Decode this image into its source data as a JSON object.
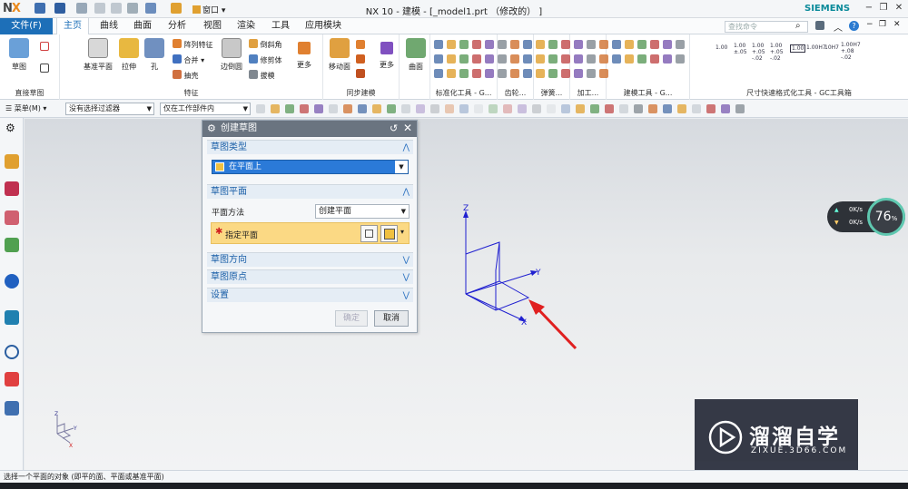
{
  "app": {
    "title": "NX 10 - 建模 - [_model1.prt （修改的） ]",
    "brand": "SIEMENS",
    "window_menu": "窗口"
  },
  "menu": {
    "file": "文件(F)",
    "tabs": [
      "主页",
      "曲线",
      "曲面",
      "分析",
      "视图",
      "渲染",
      "工具",
      "应用模块"
    ],
    "active": "主页",
    "search_placeholder": "查找命令"
  },
  "ribbon": {
    "groups": [
      {
        "label": "直接草图",
        "items": [
          "草图"
        ]
      },
      {
        "label": "特征",
        "items": [
          "基准平面",
          "拉伸",
          "孔",
          "阵列特征",
          "合并",
          "抽壳",
          "边倒圆",
          "倒斜角",
          "修剪体",
          "拔模",
          "更多"
        ]
      },
      {
        "label": "同步建模",
        "items": [
          "移动面",
          "更多"
        ]
      },
      {
        "label": "",
        "items": [
          "曲面"
        ]
      },
      {
        "label": "标准化工具 - G...",
        "items": []
      },
      {
        "label": "齿轮...",
        "items": []
      },
      {
        "label": "弹簧...",
        "items": []
      },
      {
        "label": "加工...",
        "items": []
      },
      {
        "label": "建模工具 - G...",
        "items": []
      },
      {
        "label": "尺寸快速格式化工具 - GC工具箱",
        "items": [
          "1.00",
          "1.00 ±.05",
          "1.00 +.05 -.02",
          "1.00 +.05 -.02",
          "1.00",
          "1.00H7",
          "10H7",
          "1.00H7 +.08 -.02"
        ]
      }
    ]
  },
  "selection_bar": {
    "menu": "菜单(M)",
    "filter": "没有选择过滤器",
    "scope": "仅在工作部件内"
  },
  "dialog": {
    "title": "创建草图",
    "sections": {
      "sketch_type": "草图类型",
      "sketch_plane": "草图平面",
      "sketch_orientation": "草图方向",
      "sketch_origin": "草图原点",
      "settings": "设置"
    },
    "sketch_type_value": "在平面上",
    "plane_method_label": "平面方法",
    "plane_method_value": "创建平面",
    "specify_plane": "指定平面",
    "ok": "确定",
    "cancel": "取消"
  },
  "viewport": {
    "axis_z": "Z",
    "axis_y": "Y",
    "axis_x": "X"
  },
  "perf": {
    "up": "0K/s",
    "down": "0K/s",
    "percent": "76",
    "unit": "%"
  },
  "watermark": {
    "name": "溜溜自学",
    "url": "ZIXUE.3D66.COM"
  },
  "status": {
    "message": "选择一个平面的对象 (即平的面、平面或基准平面)"
  },
  "colors": {
    "accent": "#1d6fb8",
    "selection": "#2b7ad8",
    "highlight": "#fbd984",
    "csys": "#2020d0",
    "arrow": "#e02020"
  }
}
